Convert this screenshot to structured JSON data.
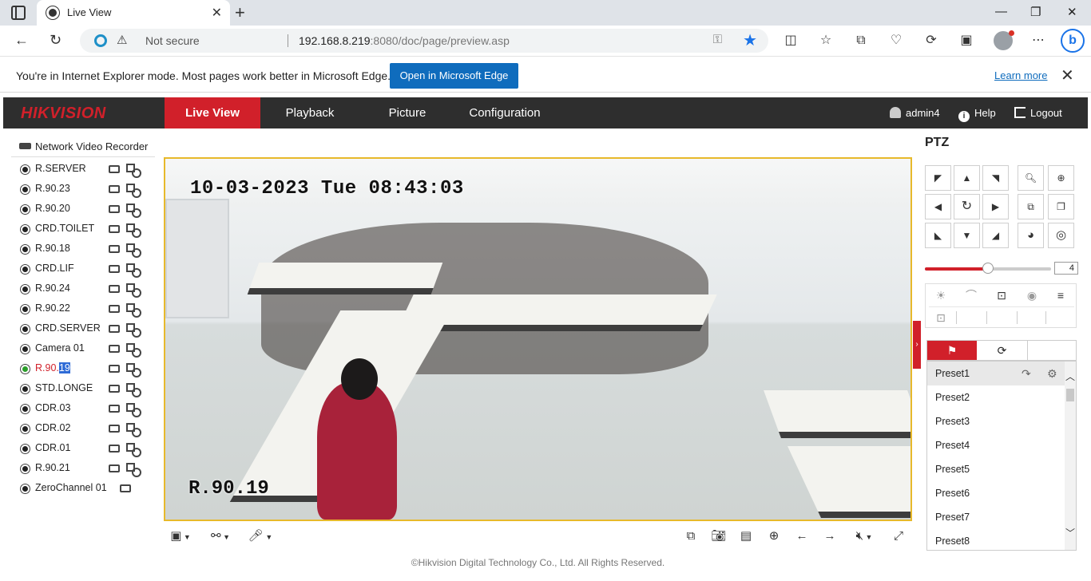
{
  "browser": {
    "tab_title": "Live View",
    "not_secure": "Not secure",
    "url_host": "192.168.8.219",
    "url_rest": ":8080/doc/page/preview.asp"
  },
  "iebar": {
    "message": "You're in Internet Explorer mode. Most pages work better in Microsoft Edge.",
    "open_button": "Open in Microsoft Edge",
    "learn_more": "Learn more"
  },
  "header": {
    "logo": "HIKVISION",
    "nav": [
      "Live View",
      "Playback",
      "Picture",
      "Configuration"
    ],
    "user": "admin4",
    "help": "Help",
    "logout": "Logout"
  },
  "tree": {
    "root": "Network Video Recorder",
    "cameras": [
      "R.SERVER",
      "R.90.23",
      "R.90.20",
      "CRD.TOILET",
      "R.90.18",
      "CRD.LIF",
      "R.90.24",
      "R.90.22",
      "CRD.SERVER",
      "Camera 01",
      "R.90.19",
      "STD.LONGE",
      "CDR.03",
      "CDR.02",
      "CDR.01",
      "R.90.21",
      "ZeroChannel 01"
    ],
    "active_camera_prefix": "R.90.",
    "active_camera_highlight": "19"
  },
  "video": {
    "timestamp": "10-03-2023 Tue 08:43:03",
    "camera_name": "R.90.19"
  },
  "footer": "©Hikvision Digital Technology Co., Ltd. All Rights Reserved.",
  "ptz": {
    "title": "PTZ",
    "speed": "4",
    "speed_level": 0.5,
    "presets": [
      "Preset1",
      "Preset2",
      "Preset3",
      "Preset4",
      "Preset5",
      "Preset6",
      "Preset7",
      "Preset8"
    ]
  },
  "colors": {
    "accent": "#d1202a",
    "header_bg": "#2e2e2e",
    "video_border": "#e7b92b",
    "edge_button": "#0f6cbd"
  }
}
